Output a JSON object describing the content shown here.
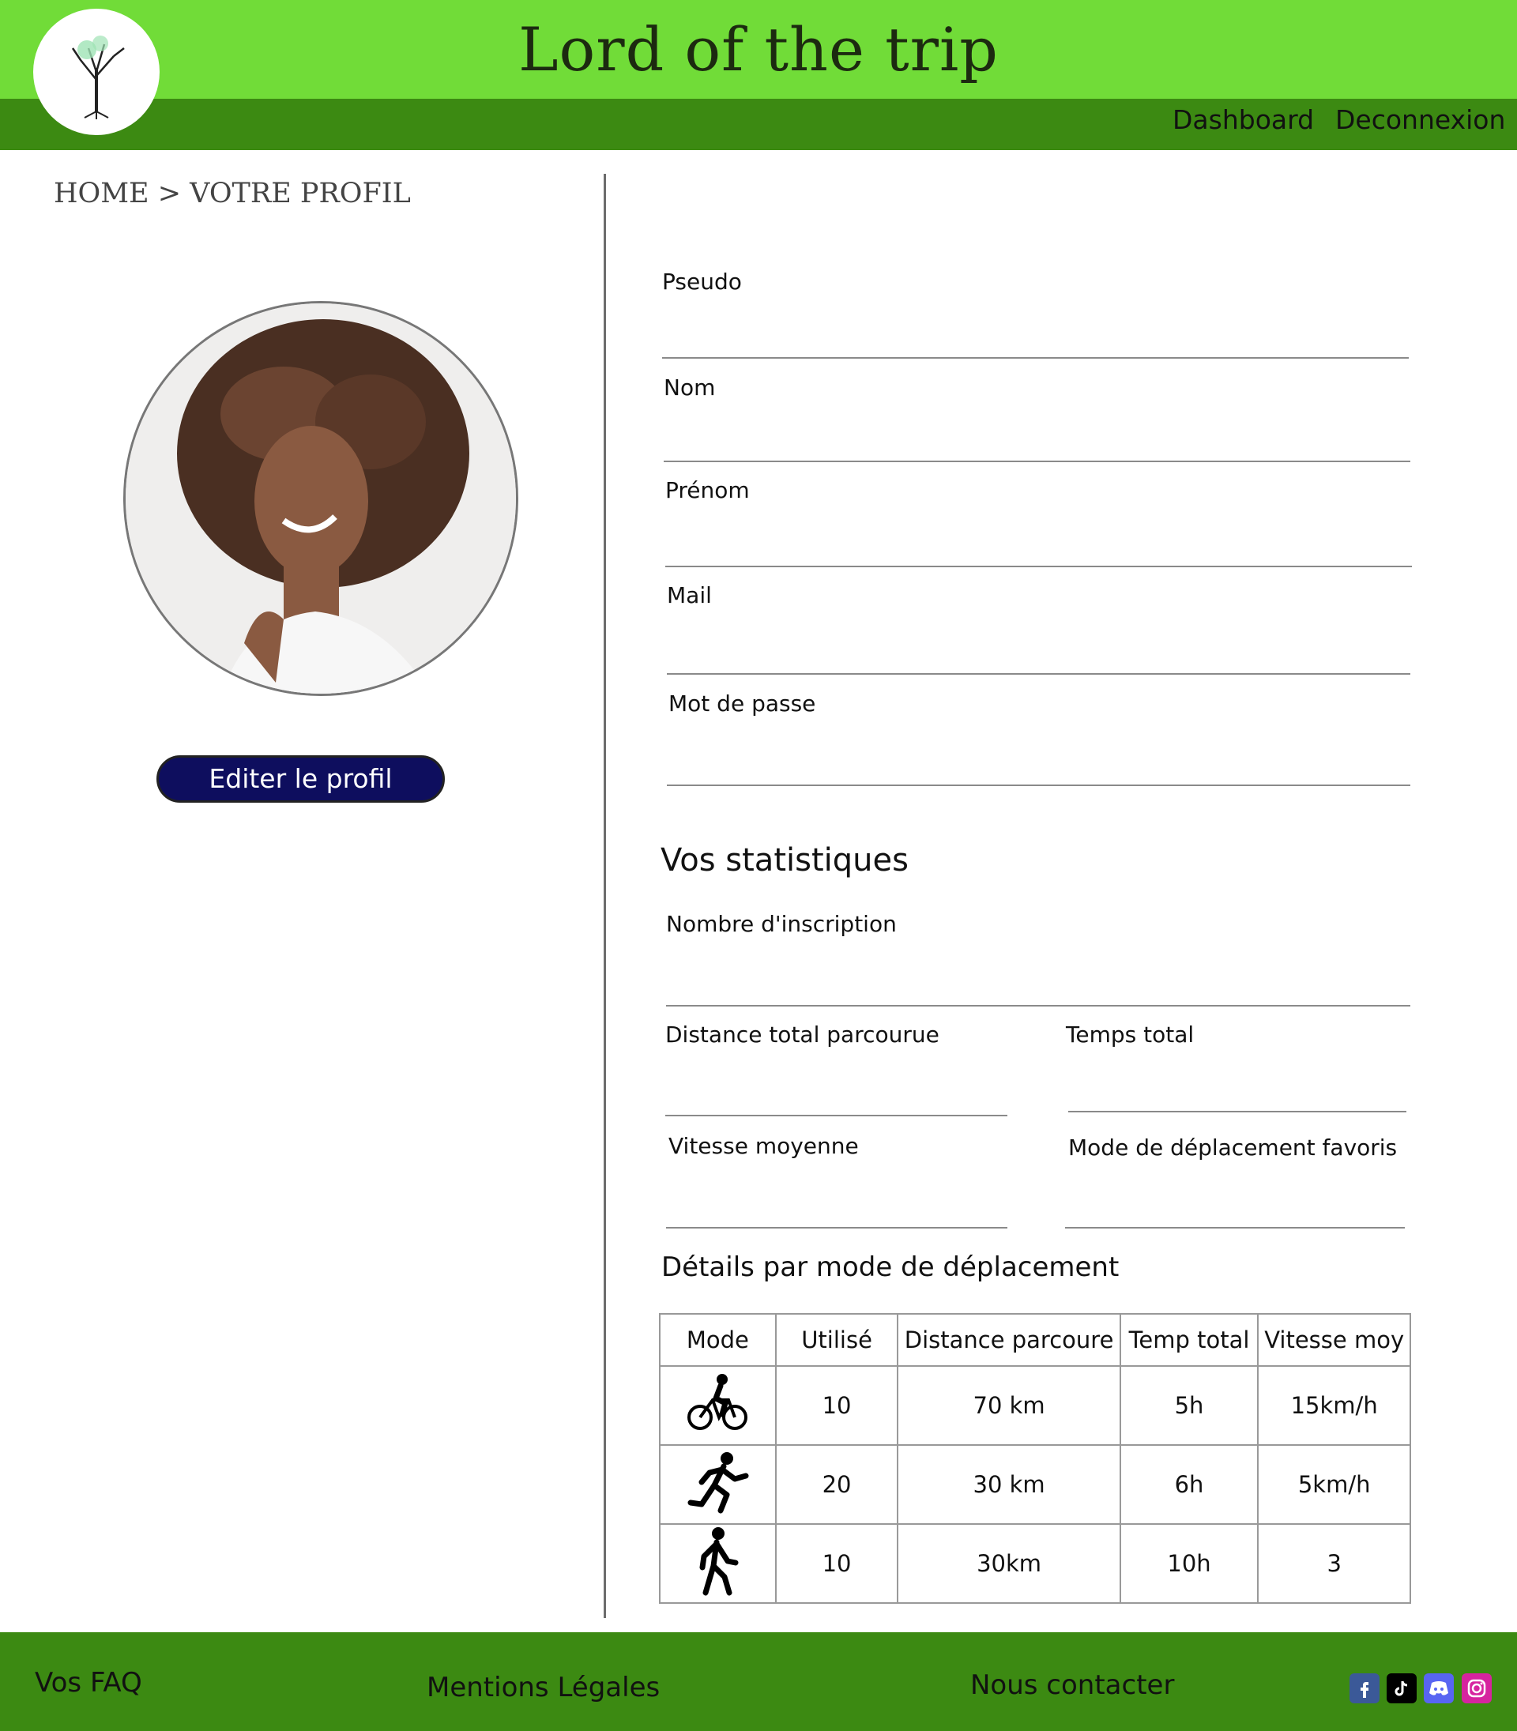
{
  "header": {
    "title": "Lord of the trip",
    "nav": {
      "dashboard": "Dashboard",
      "logout": "Deconnexion"
    },
    "logo_icon": "tree-logo-icon"
  },
  "breadcrumb": "HOME > VOTRE PROFIL",
  "profile": {
    "avatar_icon": "user-avatar",
    "edit_button": "Editer le profil"
  },
  "form": {
    "pseudo": {
      "label": "Pseudo",
      "value": ""
    },
    "nom": {
      "label": "Nom",
      "value": ""
    },
    "prenom": {
      "label": "Prénom",
      "value": ""
    },
    "mail": {
      "label": "Mail",
      "value": ""
    },
    "password": {
      "label": "Mot de passe",
      "value": ""
    }
  },
  "stats": {
    "title": "Vos statistiques",
    "inscriptions": "Nombre d'inscription",
    "distance": "Distance total parcourue",
    "time": "Temps total",
    "speed": "Vitesse moyenne",
    "mode": "Mode de déplacement favoris"
  },
  "details": {
    "title": "Détails par mode de déplacement",
    "headers": [
      "Mode",
      "Utilisé",
      "Distance parcoure",
      "Temp total",
      "Vitesse moy"
    ],
    "rows": [
      {
        "icon": "bike-icon",
        "used": "10",
        "distance": "70 km",
        "time": "5h",
        "speed": "15km/h"
      },
      {
        "icon": "run-icon",
        "used": "20",
        "distance": "30 km",
        "time": "6h",
        "speed": "5km/h"
      },
      {
        "icon": "walk-icon",
        "used": "10",
        "distance": "30km",
        "time": "10h",
        "speed": "3"
      }
    ]
  },
  "footer": {
    "faq": "Vos FAQ",
    "legal": "Mentions Légales",
    "contact": "Nous contacter",
    "social": [
      "facebook-icon",
      "tiktok-icon",
      "discord-icon",
      "instagram-icon"
    ],
    "colors": {
      "facebook": "#3b5998",
      "tiktok": "#000000",
      "discord": "#5865f2",
      "instagram": "#d6249f"
    }
  },
  "colors": {
    "header_light": "#71dc38",
    "header_dark": "#3c8a12",
    "button_bg": "#0e0e5e"
  }
}
